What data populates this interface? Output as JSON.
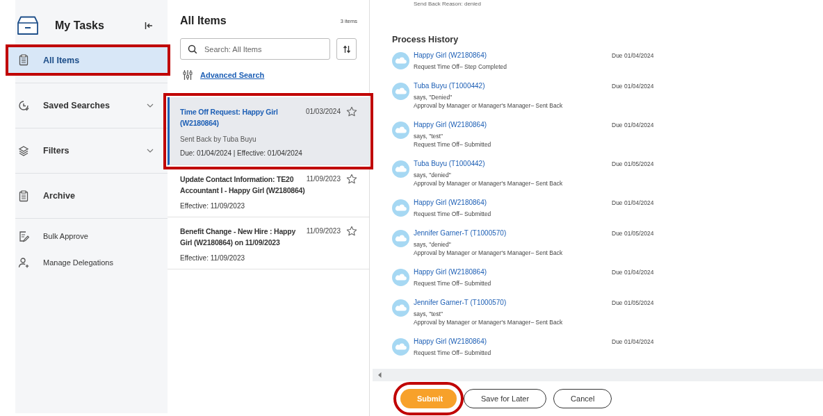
{
  "sidebar": {
    "title": "My Tasks",
    "items": [
      {
        "label": "All Items",
        "kind": "section",
        "selected": true,
        "highlighted": true,
        "chevron": false
      },
      {
        "label": "Saved Searches",
        "kind": "section",
        "selected": false,
        "highlighted": false,
        "chevron": true
      },
      {
        "label": "Filters",
        "kind": "section",
        "selected": false,
        "highlighted": false,
        "chevron": true
      },
      {
        "label": "Archive",
        "kind": "section",
        "selected": false,
        "highlighted": false,
        "chevron": false
      },
      {
        "label": "Bulk Approve",
        "kind": "action",
        "selected": false,
        "highlighted": false,
        "chevron": false
      },
      {
        "label": "Manage Delegations",
        "kind": "action",
        "selected": false,
        "highlighted": false,
        "chevron": false
      }
    ]
  },
  "list": {
    "title": "All Items",
    "count": "3 items",
    "search": {
      "placeholder": "Search: All Items"
    },
    "advanced_search": "Advanced Search",
    "tasks": [
      {
        "title": "Time Off Request: Happy Girl (W2180864)",
        "date": "01/03/2024",
        "subtitle": "Sent Back by Tuba Buyu",
        "meta": "Due: 01/04/2024 | Effective: 01/04/2024",
        "selected": true,
        "highlighted": true,
        "starred": false
      },
      {
        "title": "Update Contact Information: TE20 Accountant I - Happy Girl (W2180864)",
        "date": "11/09/2023",
        "meta": "Effective: 11/09/2023",
        "selected": false,
        "highlighted": false,
        "starred": false
      },
      {
        "title": "Benefit Change - New Hire : Happy Girl (W2180864) on 11/09/2023",
        "date": "11/09/2023",
        "meta": "Effective: 11/09/2023",
        "selected": false,
        "highlighted": false,
        "starred": false
      }
    ]
  },
  "detail": {
    "cut_line": "Send Back Reason: denied",
    "history_title": "Process History",
    "history": [
      {
        "name": "Happy Girl (W2180864)",
        "step": "Request Time Off– Step Completed",
        "due": "Due 01/04/2024"
      },
      {
        "name": "Tuba Buyu (T1000442)",
        "comment": "says, \"Denied\"",
        "step": "Approval by Manager or Manager's Manager– Sent Back",
        "due": "Due 01/04/2024"
      },
      {
        "name": "Happy Girl (W2180864)",
        "comment": "says, \"test\"",
        "step": "Request Time Off– Submitted",
        "due": "Due 01/04/2024"
      },
      {
        "name": "Tuba Buyu (T1000442)",
        "comment": "says, \"denied\"",
        "step": "Approval by Manager or Manager's Manager– Sent Back",
        "due": "Due 01/05/2024"
      },
      {
        "name": "Happy Girl (W2180864)",
        "step": "Request Time Off– Submitted",
        "due": "Due 01/04/2024"
      },
      {
        "name": "Jennifer Garner-T (T1000570)",
        "comment": "says, \"denied\"",
        "step": "Approval by Manager or Manager's Manager– Sent Back",
        "due": "Due 01/05/2024"
      },
      {
        "name": "Happy Girl (W2180864)",
        "step": "Request Time Off– Submitted",
        "due": "Due 01/04/2024"
      },
      {
        "name": "Jennifer Garner-T (T1000570)",
        "comment": "says, \"test\"",
        "step": "Approval by Manager or Manager's Manager– Sent Back",
        "due": "Due 01/05/2024"
      },
      {
        "name": "Happy Girl (W2180864)",
        "step": "Request Time Off– Submitted",
        "due": "Due 01/04/2024"
      }
    ],
    "buttons": [
      {
        "label": "Submit",
        "kind": "primary",
        "highlighted": true
      },
      {
        "label": "Save for Later",
        "kind": "secondary",
        "highlighted": false
      },
      {
        "label": "Cancel",
        "kind": "secondary",
        "highlighted": false
      }
    ]
  }
}
